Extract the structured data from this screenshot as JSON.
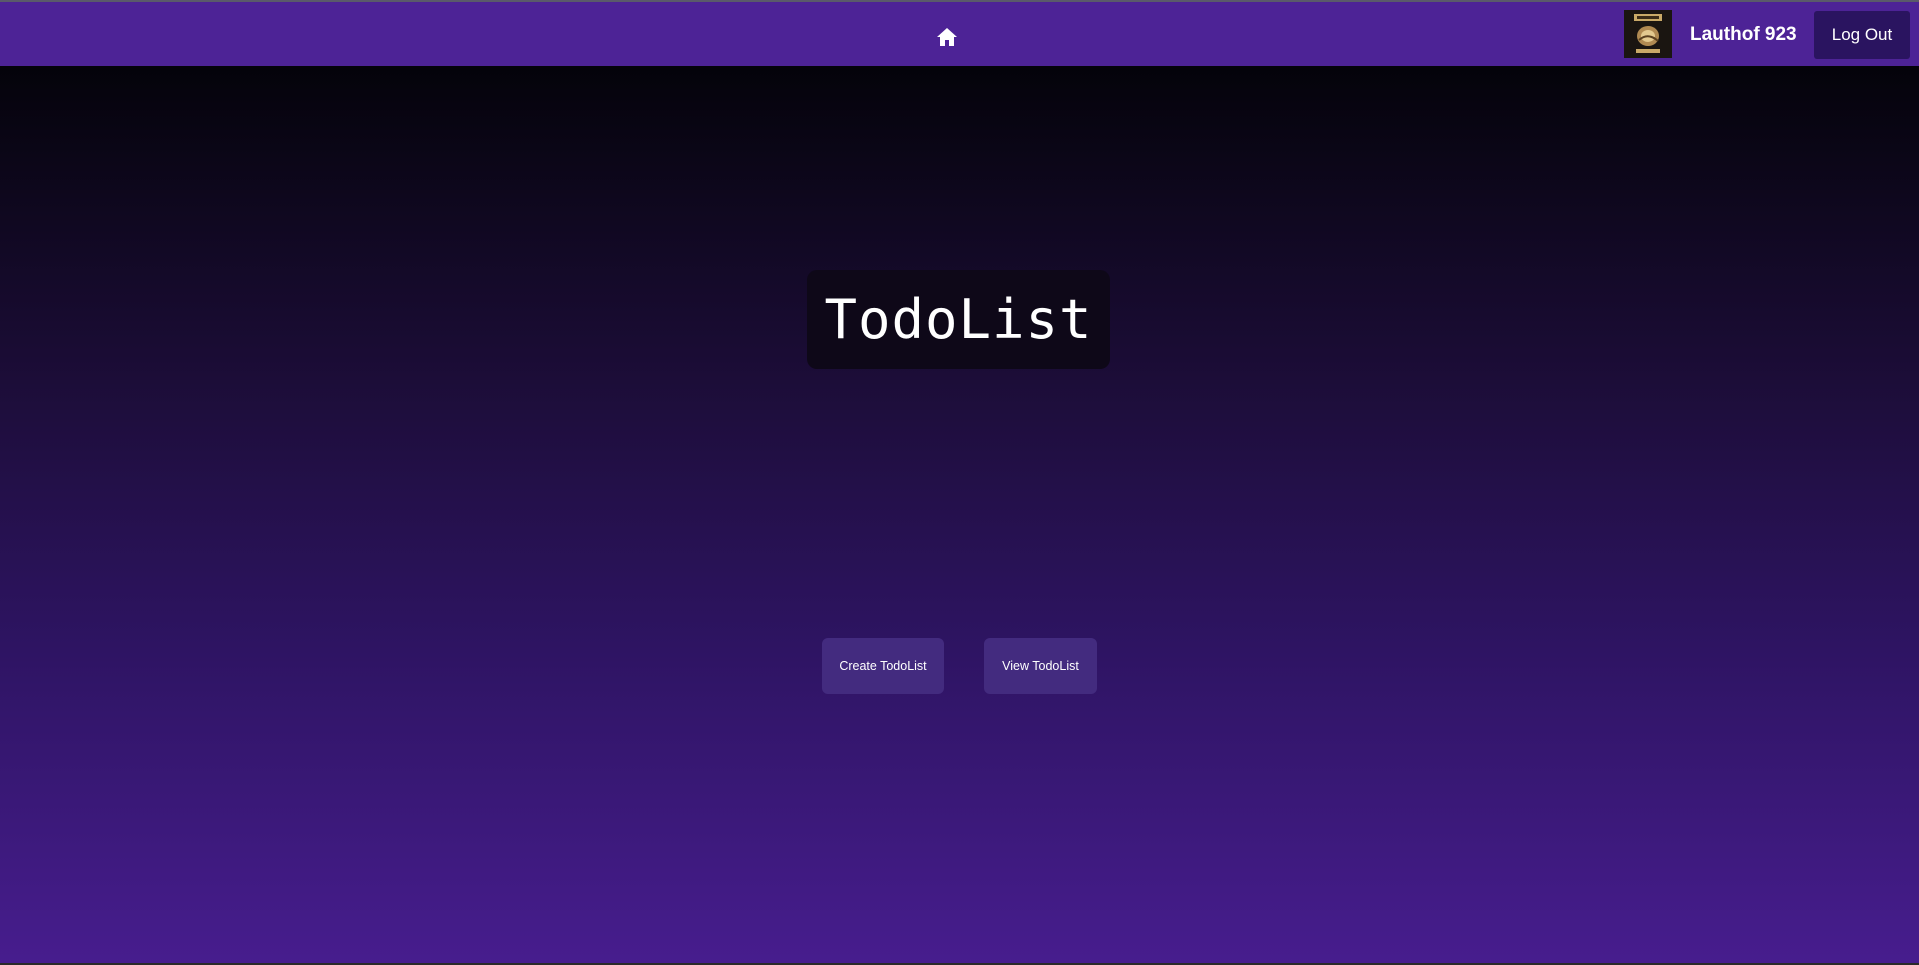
{
  "header": {
    "home_icon": "home-icon",
    "avatar_icon": "avatar-image",
    "username": "Lauthof 923",
    "logout_label": "Log Out"
  },
  "main": {
    "title": "TodoList",
    "create_label": "Create TodoList",
    "view_label": "View TodoList"
  },
  "colors": {
    "header_bg": "#4d2396",
    "logout_bg": "#2a1460",
    "button_bg": "#432b7f",
    "title_box_bg": "#0e0818",
    "gradient_top": "#04030a",
    "gradient_bottom": "#471d8e"
  }
}
